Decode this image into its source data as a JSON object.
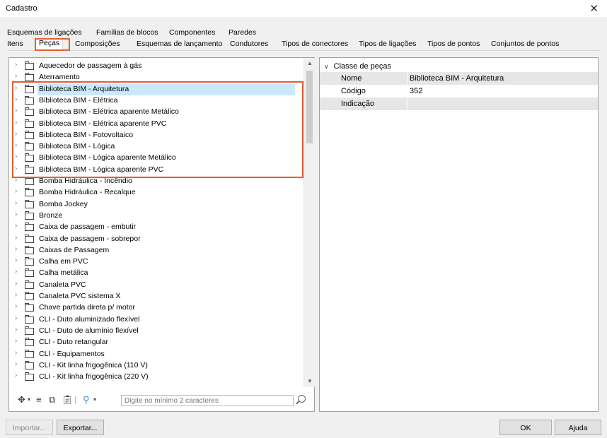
{
  "window": {
    "title": "Cadastro",
    "close_glyph": "✕"
  },
  "tabs_row1": [
    {
      "label": "Esquemas de ligações"
    },
    {
      "label": "Famílias de blocos"
    },
    {
      "label": "Componentes"
    },
    {
      "label": "Paredes"
    }
  ],
  "tabs_row2": [
    {
      "label": "Itens"
    },
    {
      "label": "Peças",
      "active": true
    },
    {
      "label": "Composições"
    },
    {
      "label": "Esquemas de lançamento"
    },
    {
      "label": "Condutores"
    },
    {
      "label": "Tipos de conectores"
    },
    {
      "label": "Tipos de ligações"
    },
    {
      "label": "Tipos de pontos"
    },
    {
      "label": "Conjuntos de pontos"
    }
  ],
  "tree": {
    "selected_index": 2,
    "items": [
      "Aquecedor de passagem à gás",
      "Aterramento",
      "Biblioteca BIM - Arquitetura",
      "Biblioteca BIM - Elétrica",
      "Biblioteca BIM - Elétrica aparente Metálico",
      "Biblioteca BIM - Elétrica aparente PVC",
      "Biblioteca BIM - Fotovoltaico",
      "Biblioteca BIM - Lógica",
      "Biblioteca BIM - Lógica aparente Metálico",
      "Biblioteca BIM - Lógica aparente PVC",
      "Bomba Hidráulica - Incêndio",
      "Bomba Hidráulica - Recalque",
      "Bomba Jockey",
      "Bronze",
      "Caixa de passagem - embutir",
      "Caixa de passagem - sobrepor",
      "Caixas de Passagem",
      "Calha em PVC",
      "Calha metálica",
      "Canaleta PVC",
      "Canaleta PVC sistema X",
      "Chave partida direta p/ motor",
      "CLI - Duto aluminizado flexível",
      "CLI - Duto de alumínio flexível",
      "CLI - Duto retangular",
      "CLI - Equipamentos",
      "CLI - Kit linha frigogênica (110 V)",
      "CLI - Kit linha frigogênica (220 V)"
    ]
  },
  "search": {
    "placeholder": "Digite no mínimo 2 caracteres"
  },
  "properties": {
    "header": "Classe de peças",
    "rows": [
      {
        "key": "Nome",
        "value": "Biblioteca BIM - Arquitetura"
      },
      {
        "key": "Código",
        "value": "352"
      },
      {
        "key": "Indicação",
        "value": ""
      }
    ]
  },
  "footer": {
    "import_label": "Importar...",
    "export_label": "Exportar...",
    "ok_label": "OK",
    "help_label": "Ajuda"
  },
  "colors": {
    "highlight": "#e45e31",
    "selection": "#cce8ff"
  }
}
